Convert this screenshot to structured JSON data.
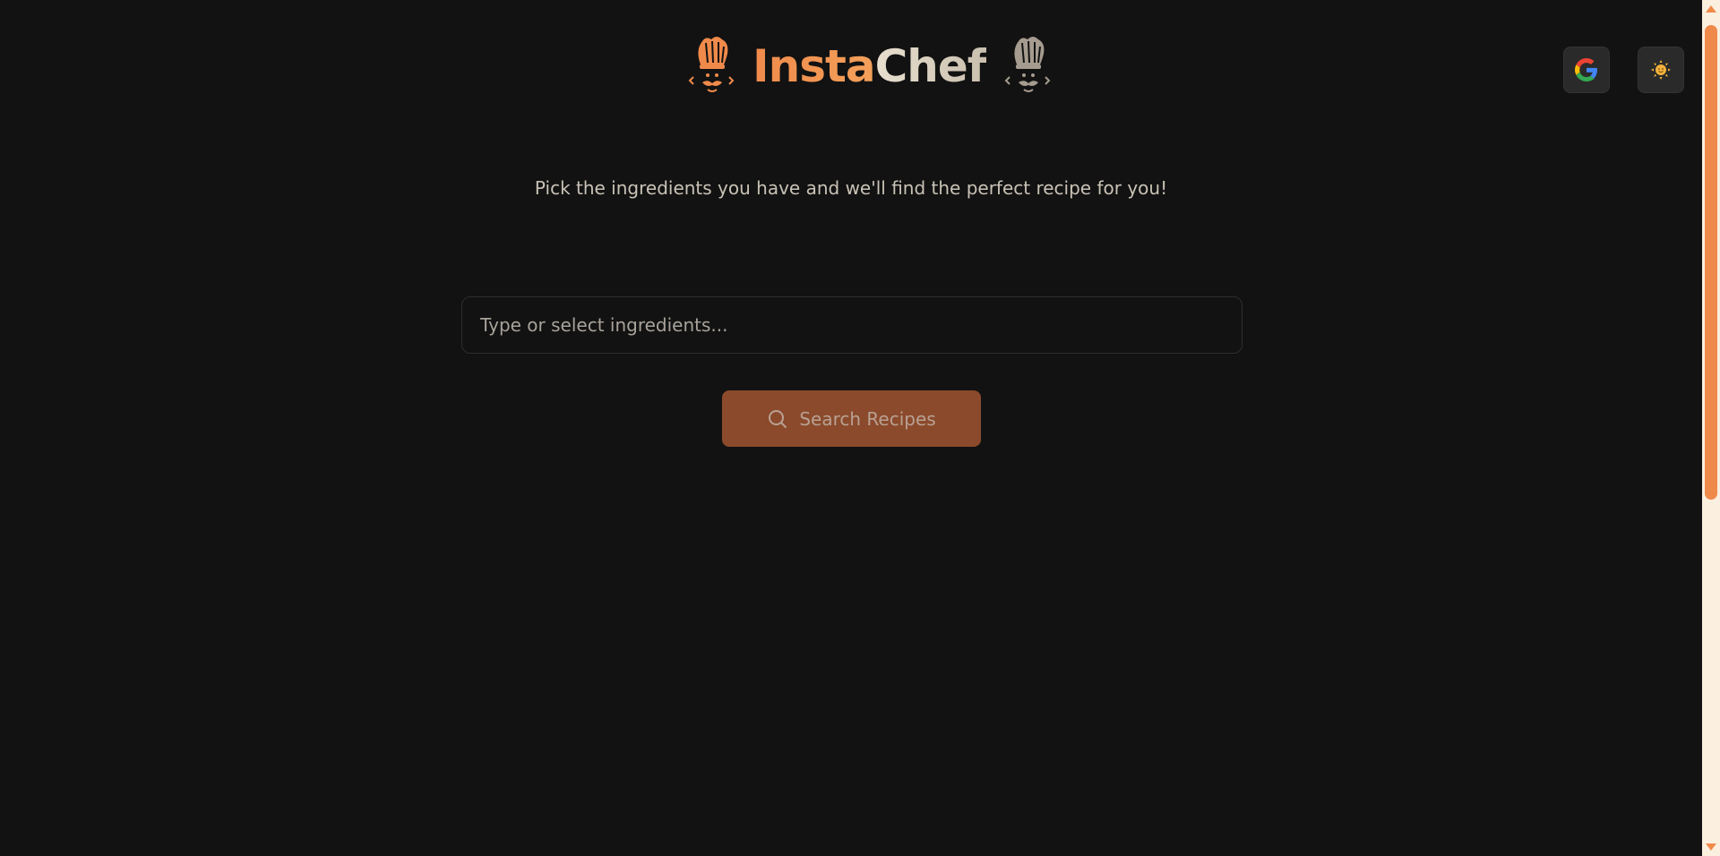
{
  "header": {
    "brand_part1": "Insta",
    "brand_part2": "Chef",
    "left_icon": "chef-hat-icon",
    "right_icon": "chef-hat-icon"
  },
  "top_right": {
    "google_icon": "google-icon",
    "theme_icon": "sun-icon"
  },
  "main": {
    "tagline": "Pick the ingredients you have and we'll find the perfect recipe for you!",
    "input_placeholder": "Type or select ingredients...",
    "search_button_label": "Search Recipes",
    "search_icon": "search-icon"
  },
  "colors": {
    "background": "#121212",
    "accent": "#f08a4b",
    "button_bg": "#8a4a2b",
    "brand_secondary": "#e2d8c8"
  }
}
